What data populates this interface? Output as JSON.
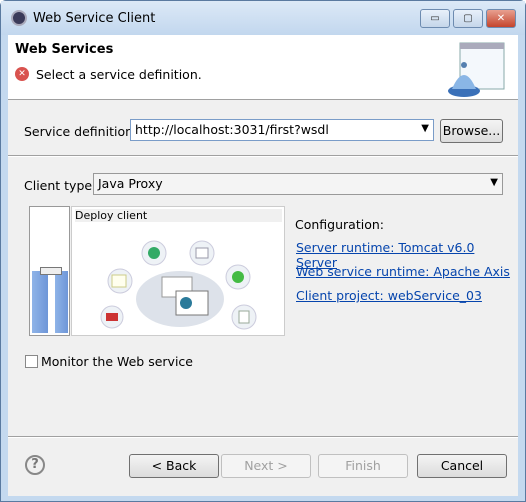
{
  "window": {
    "title": "Web Service Client",
    "minimize": "▭",
    "maximize": "▢",
    "close": "✕"
  },
  "header": {
    "title": "Web Services",
    "message": "Select a service definition.",
    "message_icon": "error-icon"
  },
  "service_definition": {
    "label": "Service definition:",
    "value": "http://localhost:3031/first?wsdl",
    "browse_label": "Browse..."
  },
  "client_type": {
    "label": "Client type:",
    "value": "Java Proxy"
  },
  "slider": {
    "level_label": "Deploy client",
    "level_fraction": 0.5
  },
  "configuration": {
    "label": "Configuration:",
    "links": [
      "Server runtime: Tomcat v6.0 Server",
      "Web service runtime: Apache Axis",
      "Client project: webService_03"
    ]
  },
  "monitor": {
    "label": "Monitor the Web service",
    "checked": false
  },
  "buttons": {
    "help": "?",
    "back": "< Back",
    "next": "Next >",
    "finish": "Finish",
    "cancel": "Cancel"
  }
}
